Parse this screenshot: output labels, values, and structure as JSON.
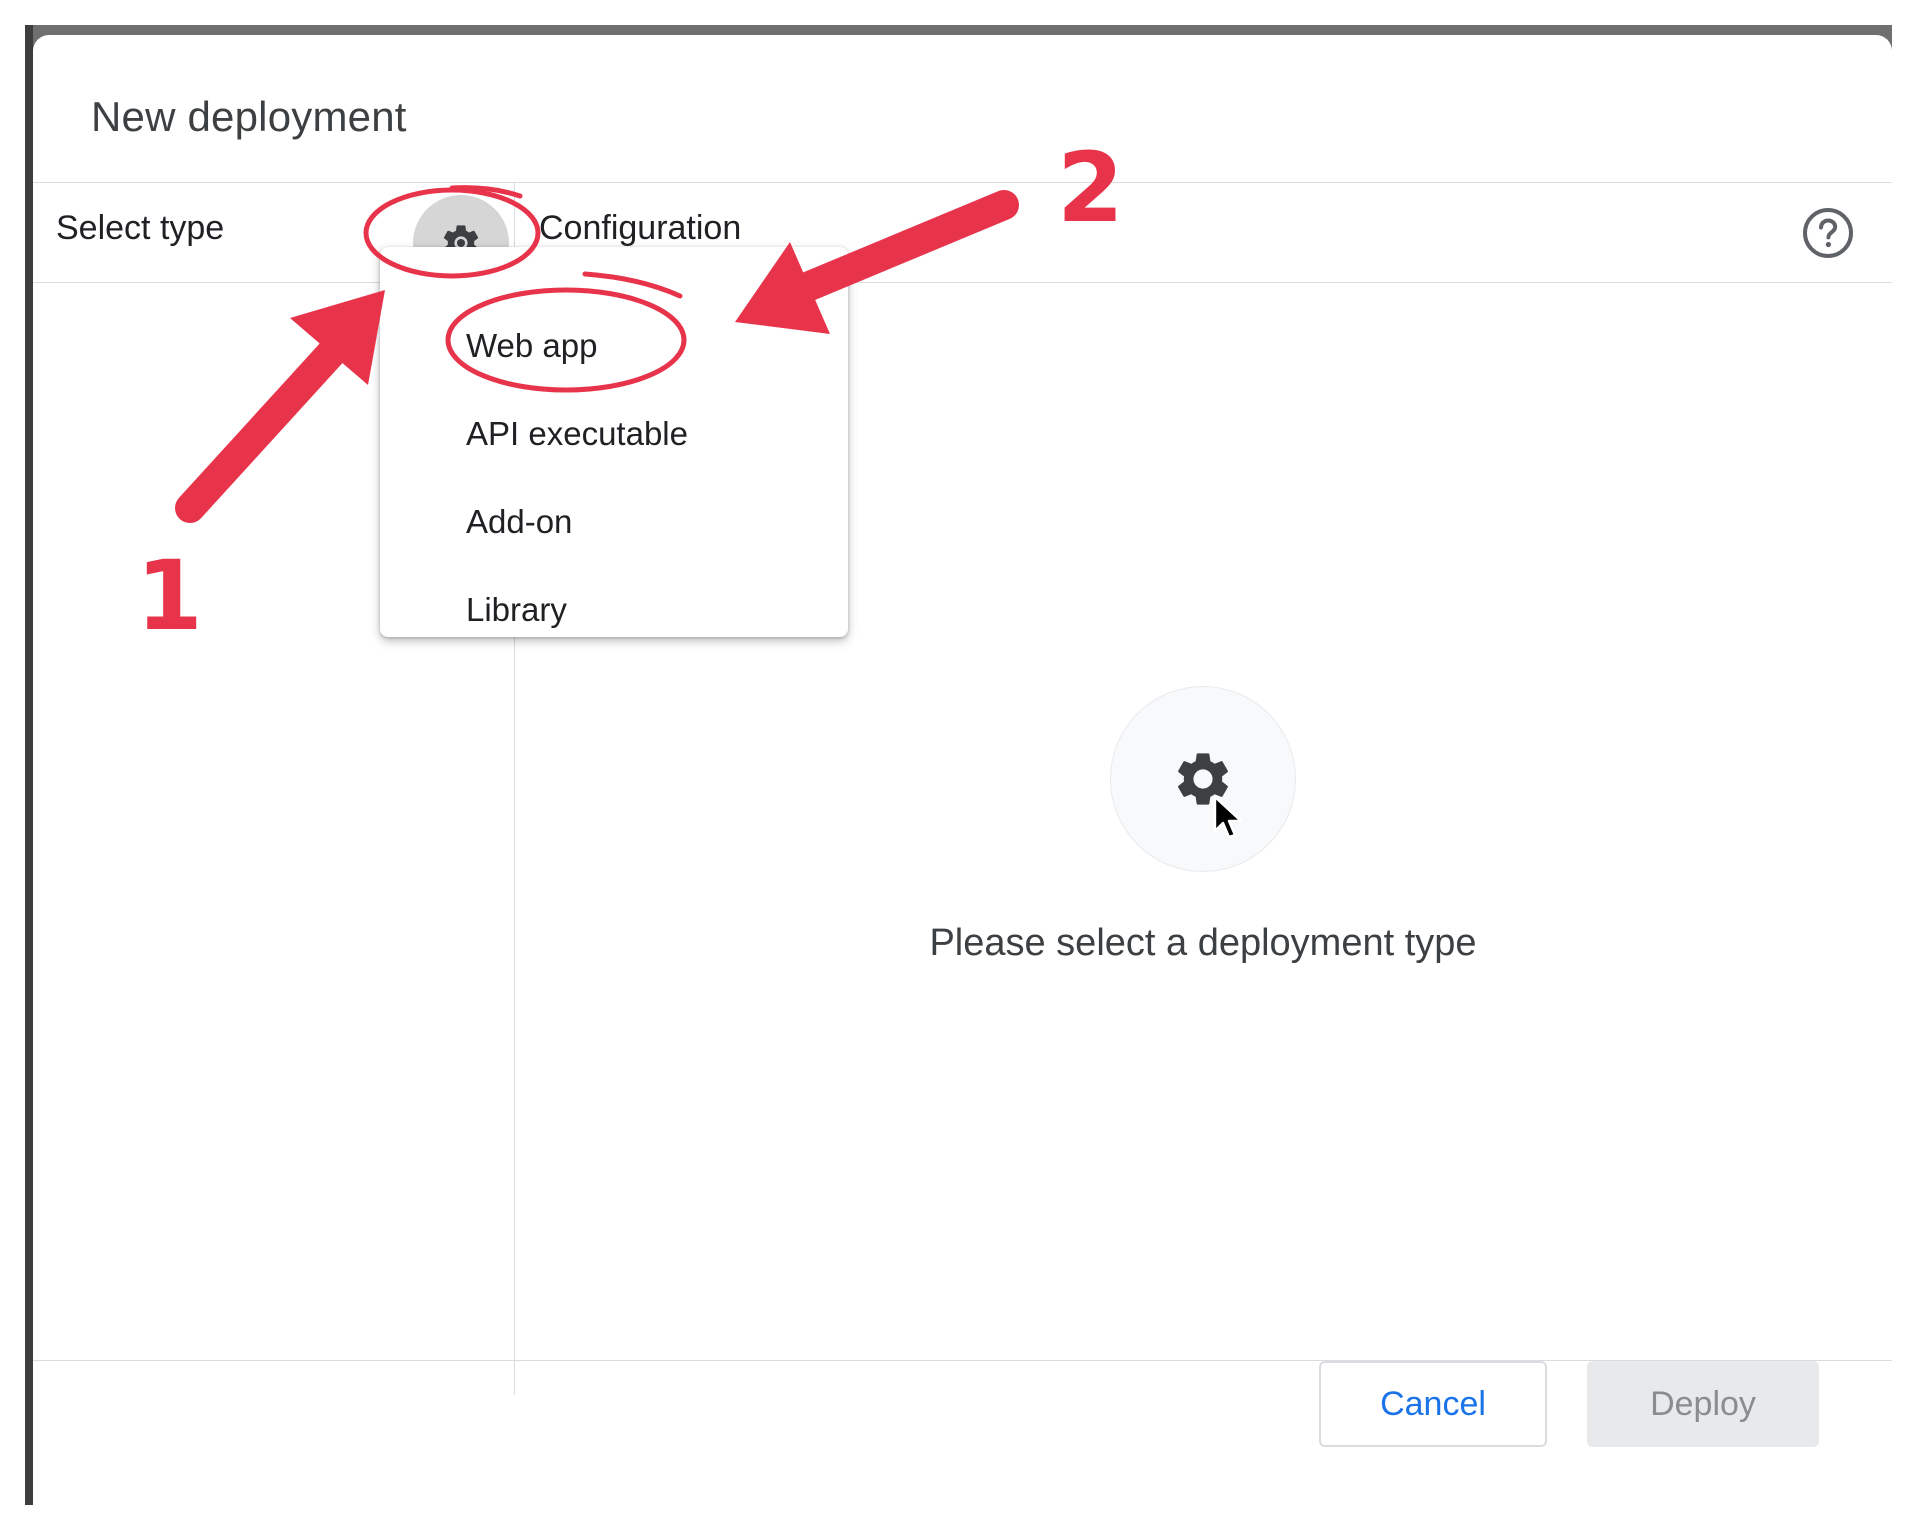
{
  "dialog": {
    "title": "New deployment"
  },
  "left_panel": {
    "header": "Select type",
    "gear_icon": "gear-icon"
  },
  "right_panel": {
    "header": "Configuration",
    "help_icon": "help-circle-icon",
    "empty_state_icon": "gear-icon",
    "empty_state_text": "Please select a deployment type"
  },
  "type_menu": {
    "items": [
      {
        "label": "Web app"
      },
      {
        "label": "API executable"
      },
      {
        "label": "Add-on"
      },
      {
        "label": "Library"
      }
    ]
  },
  "footer": {
    "cancel_label": "Cancel",
    "deploy_label": "Deploy"
  },
  "annotations": {
    "step1": "1",
    "step2": "2",
    "color": "#e8344a"
  },
  "colors": {
    "accent": "#1a73e8",
    "divider": "#dadce0",
    "gear_button_bg": "#d6d6d6",
    "deploy_disabled_bg": "#e8e9ea",
    "annotation": "#e8344a"
  }
}
